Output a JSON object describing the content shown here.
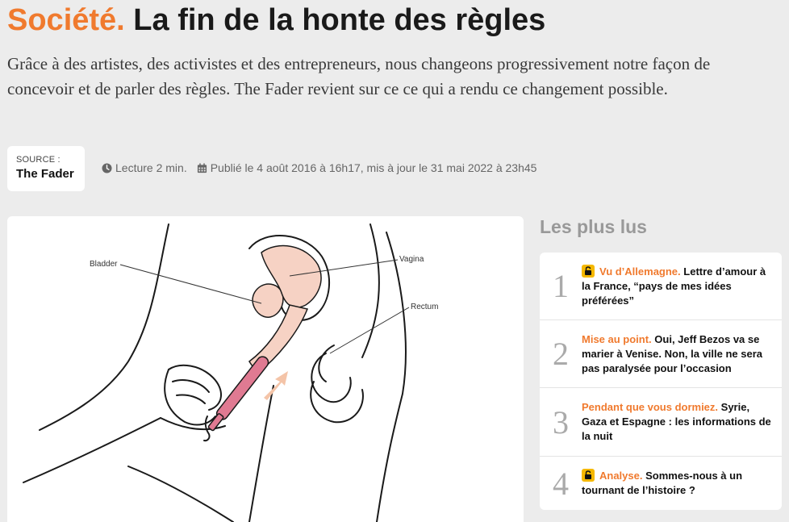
{
  "article": {
    "rubric": "Société.",
    "title": "La fin de la honte des règles",
    "lede": "Grâce à des artistes, des activistes et des entrepreneurs, nous changeons progressivement notre façon de concevoir et de parler des règles. The Fader revient sur ce ce qui a rendu ce changement possible.",
    "source_label": "SOURCE :",
    "source_name": "The Fader",
    "reading_time": "Lecture 2 min.",
    "published": "Publié le 4 août 2016 à 16h17, mis à jour le 31 mai 2022 à 23h45",
    "icons": {
      "clock": "clock-icon",
      "calendar": "calendar-icon"
    }
  },
  "figure": {
    "labels": {
      "bladder": "Bladder",
      "vagina": "Vagina",
      "rectum": "Rectum"
    }
  },
  "popular": {
    "title": "Les plus lus",
    "items": [
      {
        "num": "1",
        "locked": true,
        "rubric": "Vu d’Allemagne.",
        "text": "Lettre d’amour à la France, “pays de mes idées préférées”"
      },
      {
        "num": "2",
        "locked": false,
        "rubric": "Mise au point.",
        "text": "Oui, Jeff Bezos va se marier à Venise. Non, la ville ne sera pas paralysée pour l’occasion"
      },
      {
        "num": "3",
        "locked": false,
        "rubric": "Pendant que vous dormiez.",
        "text": "Syrie, Gaza et Espagne : les informations de la nuit"
      },
      {
        "num": "4",
        "locked": true,
        "rubric": "Analyse.",
        "text": "Sommes-nous à un tournant de l’histoire ?"
      }
    ]
  },
  "colors": {
    "accent": "#f07a2e",
    "lock": "#f5b800",
    "background": "#ececec"
  }
}
